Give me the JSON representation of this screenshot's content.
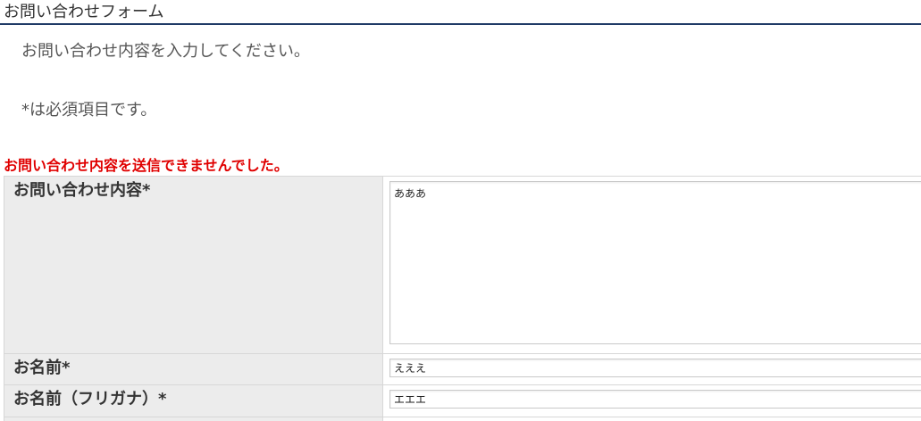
{
  "form": {
    "title": "お問い合わせフォーム",
    "intro": "お問い合わせ内容を入力してください。",
    "required_note": "*は必須項目です。",
    "error": "お問い合わせ内容を送信できませんでした。"
  },
  "fields": {
    "inquiry": {
      "label": "お問い合わせ内容*",
      "value": "あああ"
    },
    "name": {
      "label": "お名前*",
      "value": "えええ"
    },
    "name_kana": {
      "label": "お名前（フリガナ）*",
      "value": "エエエ"
    }
  },
  "colors": {
    "title_underline": "#1f3a66",
    "error": "#e00000",
    "label_bg": "#ececec",
    "border": "#d7d7d7"
  }
}
